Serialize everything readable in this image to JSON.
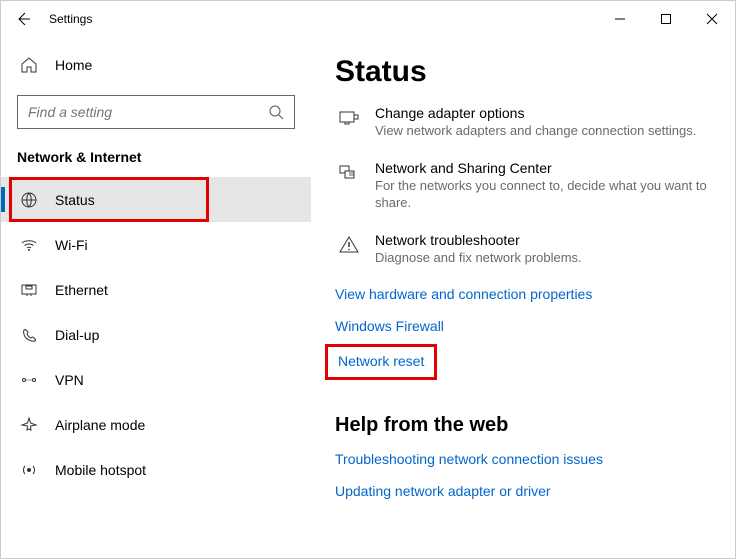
{
  "titlebar": {
    "title": "Settings"
  },
  "sidebar": {
    "home_label": "Home",
    "search_placeholder": "Find a setting",
    "category_label": "Network & Internet",
    "items": [
      {
        "label": "Status"
      },
      {
        "label": "Wi-Fi"
      },
      {
        "label": "Ethernet"
      },
      {
        "label": "Dial-up"
      },
      {
        "label": "VPN"
      },
      {
        "label": "Airplane mode"
      },
      {
        "label": "Mobile hotspot"
      }
    ]
  },
  "main": {
    "heading": "Status",
    "options": [
      {
        "title": "Change adapter options",
        "desc": "View network adapters and change connection settings."
      },
      {
        "title": "Network and Sharing Center",
        "desc": "For the networks you connect to, decide what you want to share."
      },
      {
        "title": "Network troubleshooter",
        "desc": "Diagnose and fix network problems."
      }
    ],
    "links": {
      "hardware": "View hardware and connection properties",
      "firewall": "Windows Firewall",
      "reset": "Network reset"
    },
    "help_heading": "Help from the web",
    "help_links": {
      "troubleshoot": "Troubleshooting network connection issues",
      "update": "Updating network adapter or driver"
    }
  }
}
